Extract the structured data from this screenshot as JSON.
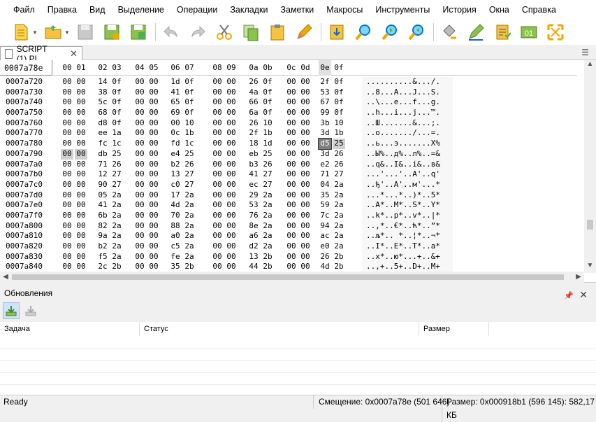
{
  "menu": [
    "Файл",
    "Правка",
    "Вид",
    "Выделение",
    "Операции",
    "Закладки",
    "Заметки",
    "Макросы",
    "Инструменты",
    "История",
    "Окна",
    "Справка"
  ],
  "toolbar": {
    "icons": [
      "new-document-icon",
      "open-folder-icon",
      "save-icon",
      "save-as-icon",
      "save-all-icon",
      "undo-icon",
      "redo-icon",
      "cut-icon",
      "copy-icon",
      "paste-icon",
      "pencil-icon",
      "insert-icon",
      "find-icon",
      "find-next-icon",
      "find-previous-icon",
      "fill-icon",
      "edit-icon",
      "checksum-icon",
      "binary-icon",
      "fullscreen-icon"
    ]
  },
  "tab": {
    "label": "SCRIPT (1).PL"
  },
  "hex": {
    "address_header": "0007a78e",
    "columns": [
      "00",
      "01",
      "02",
      "03",
      "04",
      "05",
      "06",
      "07",
      "08",
      "09",
      "0a",
      "0b",
      "0c",
      "0d",
      "0e",
      "0f"
    ],
    "rows": [
      {
        "addr": "0007a720",
        "bytes": [
          "00",
          "00",
          "14",
          "0f",
          "00",
          "00",
          "1d",
          "0f",
          "00",
          "00",
          "26",
          "0f",
          "00",
          "00",
          "2f",
          "0f"
        ],
        "ascii": "..........&.../."
      },
      {
        "addr": "0007a730",
        "bytes": [
          "00",
          "00",
          "38",
          "0f",
          "00",
          "00",
          "41",
          "0f",
          "00",
          "00",
          "4a",
          "0f",
          "00",
          "00",
          "53",
          "0f"
        ],
        "ascii": "..8...A...J...S."
      },
      {
        "addr": "0007a740",
        "bytes": [
          "00",
          "00",
          "5c",
          "0f",
          "00",
          "00",
          "65",
          "0f",
          "00",
          "00",
          "66",
          "0f",
          "00",
          "00",
          "67",
          "0f"
        ],
        "ascii": "..\\...e...f...g."
      },
      {
        "addr": "0007a750",
        "bytes": [
          "00",
          "00",
          "68",
          "0f",
          "00",
          "00",
          "69",
          "0f",
          "00",
          "00",
          "6a",
          "0f",
          "00",
          "00",
          "99",
          "0f"
        ],
        "ascii": "..h...i...j...™."
      },
      {
        "addr": "0007a760",
        "bytes": [
          "00",
          "00",
          "d8",
          "0f",
          "00",
          "00",
          "00",
          "10",
          "00",
          "00",
          "26",
          "10",
          "00",
          "00",
          "3b",
          "10"
        ],
        "ascii": "..Ш.......&...;."
      },
      {
        "addr": "0007a770",
        "bytes": [
          "00",
          "00",
          "ee",
          "1a",
          "00",
          "00",
          "0c",
          "1b",
          "00",
          "00",
          "2f",
          "1b",
          "00",
          "00",
          "3d",
          "1b"
        ],
        "ascii": "..о......./...=."
      },
      {
        "addr": "0007a780",
        "bytes": [
          "00",
          "00",
          "fc",
          "1c",
          "00",
          "00",
          "fd",
          "1c",
          "00",
          "00",
          "18",
          "1d",
          "00",
          "00",
          "d5",
          "25"
        ],
        "ascii": "..ь...э.......Х%"
      },
      {
        "addr": "0007a790",
        "bytes": [
          "00",
          "00",
          "db",
          "25",
          "00",
          "00",
          "e4",
          "25",
          "00",
          "00",
          "eb",
          "25",
          "00",
          "00",
          "3d",
          "26"
        ],
        "ascii": "..Ы%..д%..л%..=&"
      },
      {
        "addr": "0007a7a0",
        "bytes": [
          "00",
          "00",
          "71",
          "26",
          "00",
          "00",
          "b2",
          "26",
          "00",
          "00",
          "b3",
          "26",
          "00",
          "00",
          "e2",
          "26"
        ],
        "ascii": "..q&..І&..і&..в&"
      },
      {
        "addr": "0007a7b0",
        "bytes": [
          "00",
          "00",
          "12",
          "27",
          "00",
          "00",
          "13",
          "27",
          "00",
          "00",
          "41",
          "27",
          "00",
          "00",
          "71",
          "27"
        ],
        "ascii": "...'...'..A'..q'"
      },
      {
        "addr": "0007a7c0",
        "bytes": [
          "00",
          "00",
          "90",
          "27",
          "00",
          "00",
          "c0",
          "27",
          "00",
          "00",
          "ec",
          "27",
          "00",
          "00",
          "04",
          "2a"
        ],
        "ascii": "..ђ'..А'..м'...*"
      },
      {
        "addr": "0007a7d0",
        "bytes": [
          "00",
          "00",
          "05",
          "2a",
          "00",
          "00",
          "17",
          "2a",
          "00",
          "00",
          "29",
          "2a",
          "00",
          "00",
          "35",
          "2a"
        ],
        "ascii": "...*...*..)*..5*"
      },
      {
        "addr": "0007a7e0",
        "bytes": [
          "00",
          "00",
          "41",
          "2a",
          "00",
          "00",
          "4d",
          "2a",
          "00",
          "00",
          "53",
          "2a",
          "00",
          "00",
          "59",
          "2a"
        ],
        "ascii": "..A*..M*..S*..Y*"
      },
      {
        "addr": "0007a7f0",
        "bytes": [
          "00",
          "00",
          "6b",
          "2a",
          "00",
          "00",
          "70",
          "2a",
          "00",
          "00",
          "76",
          "2a",
          "00",
          "00",
          "7c",
          "2a"
        ],
        "ascii": "..k*..p*..v*..|*"
      },
      {
        "addr": "0007a800",
        "bytes": [
          "00",
          "00",
          "82",
          "2a",
          "00",
          "00",
          "88",
          "2a",
          "00",
          "00",
          "8e",
          "2a",
          "00",
          "00",
          "94",
          "2a"
        ],
        "ascii": "..‚*..€*..ћ*..”*"
      },
      {
        "addr": "0007a810",
        "bytes": [
          "00",
          "00",
          "9a",
          "2a",
          "00",
          "00",
          "a0",
          "2a",
          "00",
          "00",
          "a6",
          "2a",
          "00",
          "00",
          "ac",
          "2a"
        ],
        "ascii": "..љ*.. *..¦*..¬*"
      },
      {
        "addr": "0007a820",
        "bytes": [
          "00",
          "00",
          "b2",
          "2a",
          "00",
          "00",
          "c5",
          "2a",
          "00",
          "00",
          "d2",
          "2a",
          "00",
          "00",
          "e0",
          "2a"
        ],
        "ascii": "..І*..Е*..Т*..а*"
      },
      {
        "addr": "0007a830",
        "bytes": [
          "00",
          "00",
          "f5",
          "2a",
          "00",
          "00",
          "fe",
          "2a",
          "00",
          "00",
          "13",
          "2b",
          "00",
          "00",
          "26",
          "2b"
        ],
        "ascii": "..х*..ю*...+..&+"
      },
      {
        "addr": "0007a840",
        "bytes": [
          "00",
          "00",
          "2c",
          "2b",
          "00",
          "00",
          "35",
          "2b",
          "00",
          "00",
          "44",
          "2b",
          "00",
          "00",
          "4d",
          "2b"
        ],
        "ascii": "..,+..5+..D+..M+"
      }
    ]
  },
  "updates": {
    "title": "Обновления",
    "columns": [
      "Задача",
      "Статус",
      "Размер"
    ],
    "tool_icons": [
      "download-active-icon",
      "download-icon"
    ]
  },
  "status": {
    "ready": "Ready",
    "offset": "Смещение: 0x0007a78e (501 646)",
    "size": "Размер: 0x000918b1 (596 145): 582,17 КБ"
  },
  "colors": {
    "accent": "#f0a800",
    "selection": "#d0d0d0",
    "cursor": "#808080"
  }
}
